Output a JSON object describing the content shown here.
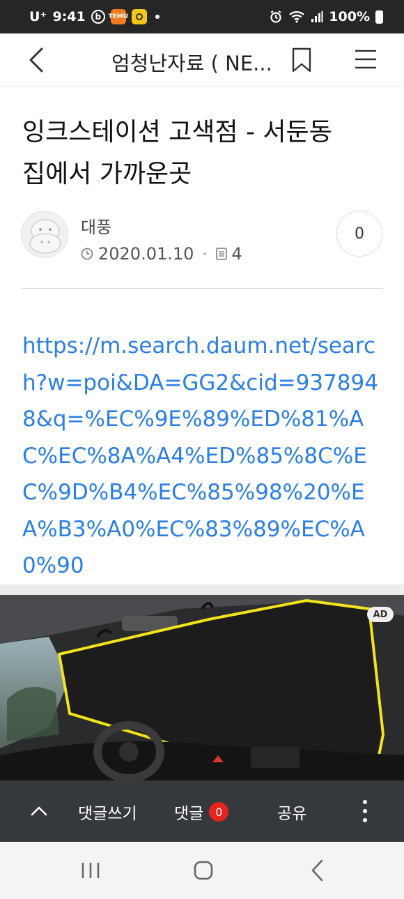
{
  "status_bar": {
    "carrier": "U⁺",
    "time": "9:41",
    "badge_temu": "TEMU",
    "badge_b": "b",
    "battery": "100%"
  },
  "header": {
    "title": "엄청난자료 ( NE...",
    "icons": {
      "back": "chevron-left-icon",
      "bookmark": "bookmark-icon",
      "menu": "hamburger-menu-icon"
    }
  },
  "article": {
    "title_line1": "잉크스테이션 고색점 - 서둔동",
    "title_line2": "집에서 가까운곳",
    "author": "대풍",
    "date": "2020.01.10",
    "views": "4",
    "comment_count": "0",
    "link": "https://m.search.daum.net/search?w=poi&DA=GG2&cid=9378948&q=%EC%9E%89%ED%81%AC%EC%8A%A4%ED%85%8C%EC%9D%B4%EC%85%98%20%EA%B3%A0%EC%83%89%EC%A0%90"
  },
  "ad": {
    "badge": "AD",
    "colors": {
      "accent": "#f2e41a",
      "interior": "#1c1c1c"
    }
  },
  "action_bar": {
    "write_comment": "댓글쓰기",
    "comments": "댓글",
    "comments_count": "0",
    "share": "공유",
    "colors": {
      "background": "#35383d",
      "badge": "#e3251c"
    }
  },
  "colors": {
    "link": "#2a7ee8",
    "text": "#111111"
  }
}
